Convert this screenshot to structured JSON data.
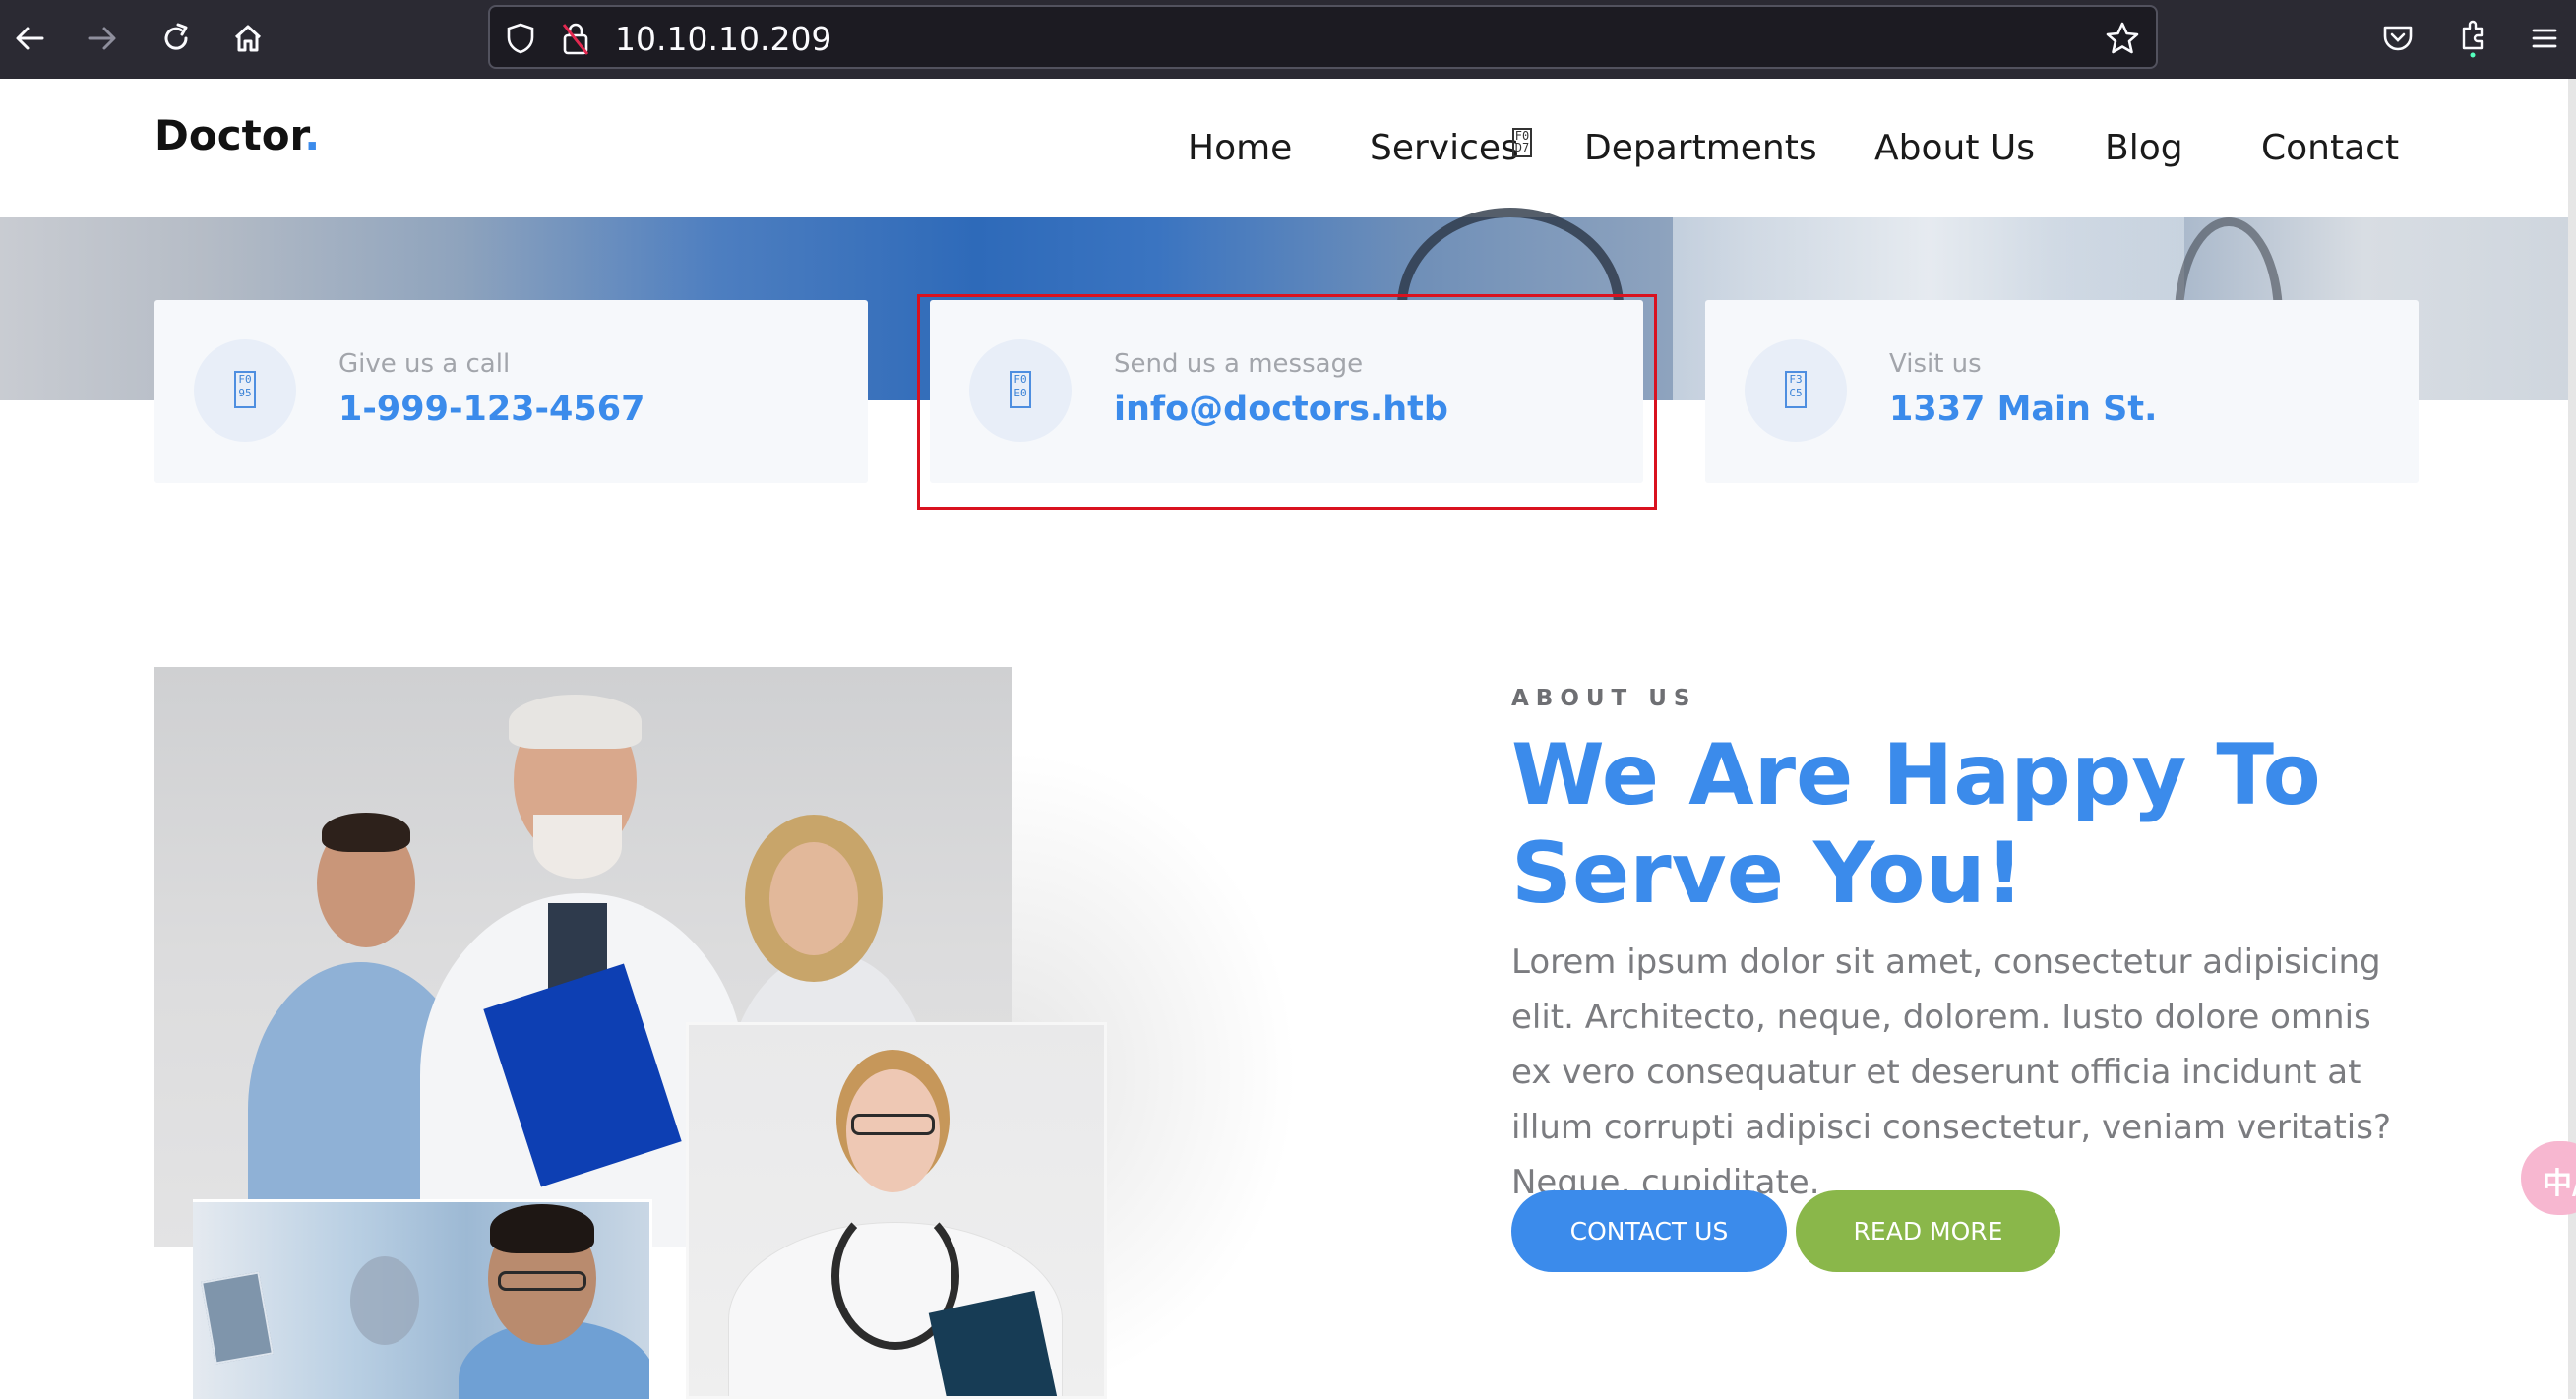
{
  "browser": {
    "url": "10.10.10.209"
  },
  "site": {
    "brand": "Doctor",
    "brand_dot": "."
  },
  "nav": {
    "items": [
      "Home",
      "Services",
      "Departments",
      "About Us",
      "Blog",
      "Contact"
    ],
    "services_dropdown_glyph": "F0 D7"
  },
  "contact_cards": [
    {
      "label": "Give us a call",
      "value": "1-999-123-4567",
      "icon_glyph": "F0 95"
    },
    {
      "label": "Send us a message",
      "value": "info@doctors.htb",
      "icon_glyph": "F0 E0"
    },
    {
      "label": "Visit us",
      "value": "1337 Main St.",
      "icon_glyph": "F3 C5"
    }
  ],
  "about": {
    "eyebrow": "ABOUT US",
    "headline_line1": "We Are Happy To",
    "headline_line2": "Serve You!",
    "paragraph": "Lorem ipsum dolor sit amet, consectetur adipisicing elit. Architecto, neque, dolorem. Iusto dolore omnis ex vero consequatur et deserunt officia incidunt at illum corrupti adipisci consectetur, veniam veritatis? Neque, cupiditate.",
    "contact_button": "CONTACT US",
    "read_more_button": "READ MORE"
  },
  "widget": {
    "label": "中/"
  },
  "colors": {
    "accent": "#3b8beb",
    "secondary": "#8ab74a",
    "highlight": "#d9121f",
    "chrome": "#2b2a33"
  }
}
